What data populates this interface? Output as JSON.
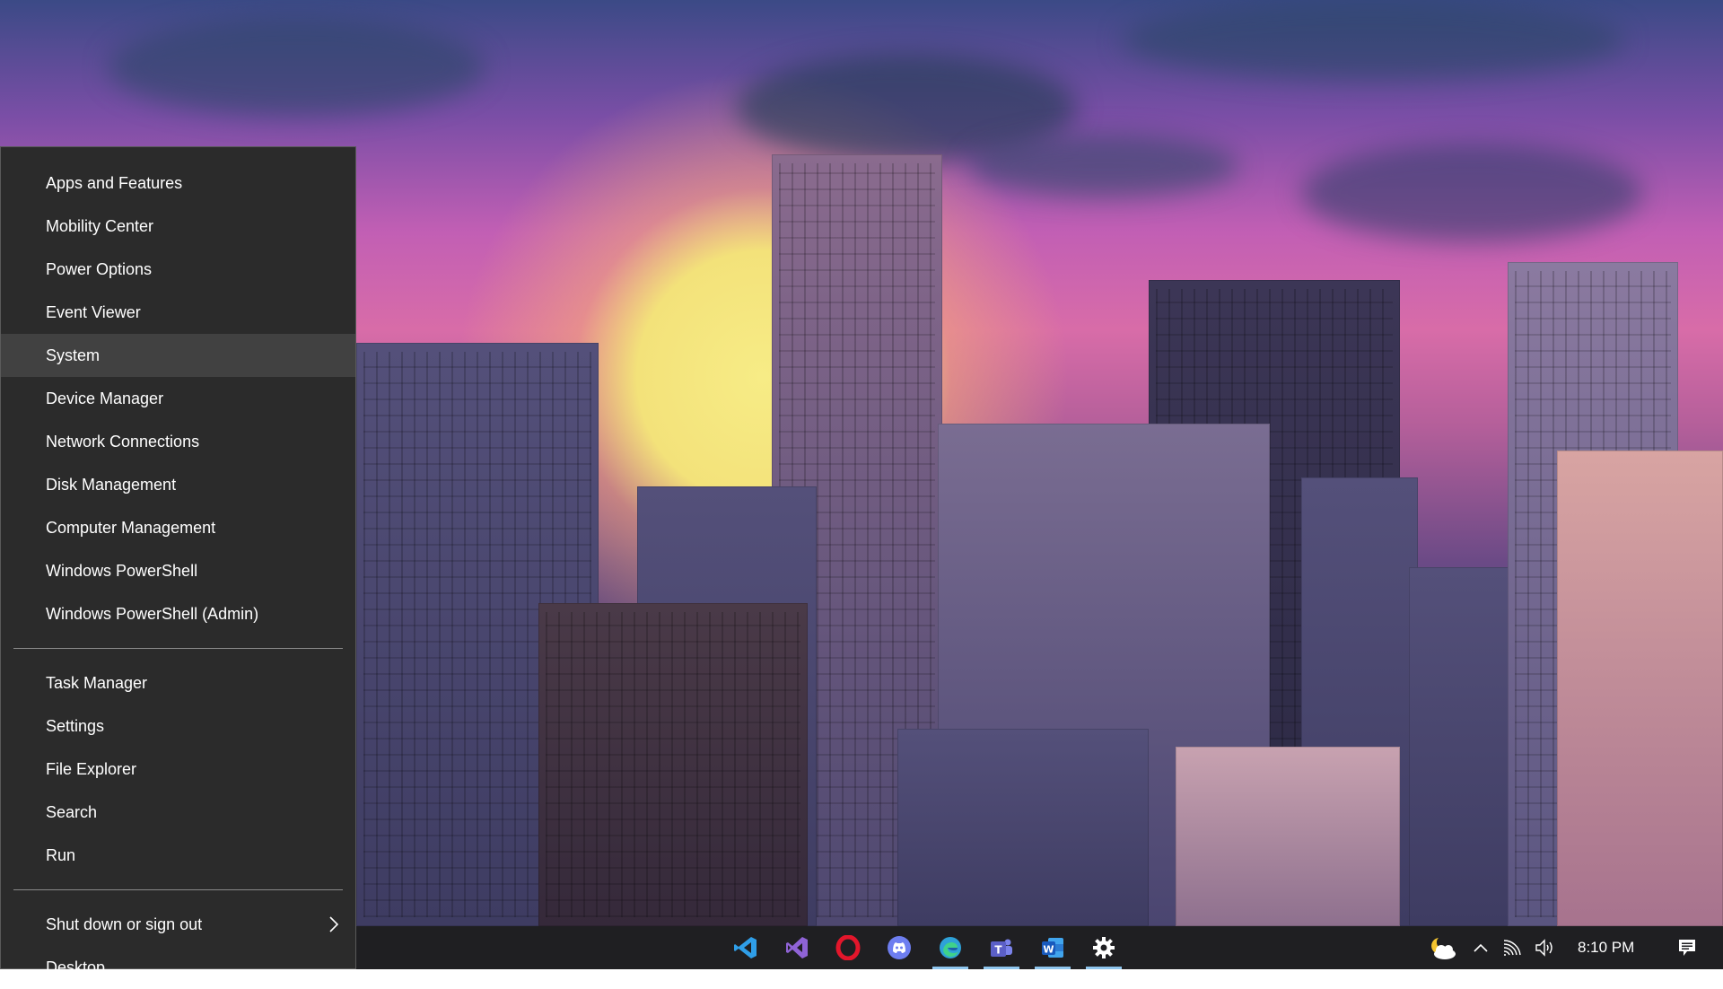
{
  "menu": {
    "sections": [
      {
        "items": [
          {
            "label": "Apps and Features",
            "selected": false
          },
          {
            "label": "Mobility Center",
            "selected": false
          },
          {
            "label": "Power Options",
            "selected": false
          },
          {
            "label": "Event Viewer",
            "selected": false
          },
          {
            "label": "System",
            "selected": true
          },
          {
            "label": "Device Manager",
            "selected": false
          },
          {
            "label": "Network Connections",
            "selected": false
          },
          {
            "label": "Disk Management",
            "selected": false
          },
          {
            "label": "Computer Management",
            "selected": false
          },
          {
            "label": "Windows PowerShell",
            "selected": false
          },
          {
            "label": "Windows PowerShell (Admin)",
            "selected": false
          }
        ]
      },
      {
        "items": [
          {
            "label": "Task Manager",
            "selected": false
          },
          {
            "label": "Settings",
            "selected": false
          },
          {
            "label": "File Explorer",
            "selected": false
          },
          {
            "label": "Search",
            "selected": false
          },
          {
            "label": "Run",
            "selected": false
          }
        ]
      },
      {
        "items": [
          {
            "label": "Shut down or sign out",
            "selected": false,
            "submenu": true
          },
          {
            "label": "Desktop",
            "selected": false
          }
        ]
      }
    ]
  },
  "taskbar": {
    "apps": [
      {
        "name": "vscode-icon",
        "running": false,
        "color": "#2f9ee8"
      },
      {
        "name": "visual-studio-icon",
        "running": false,
        "color": "#8f63d6"
      },
      {
        "name": "opera-icon",
        "running": false,
        "color": "#e3162b"
      },
      {
        "name": "discord-icon",
        "running": false,
        "color": "#6e7ef0"
      },
      {
        "name": "edge-icon",
        "running": true,
        "color": "#2ea1d8"
      },
      {
        "name": "teams-icon",
        "running": true,
        "color": "#5b5fc7"
      },
      {
        "name": "word-icon",
        "running": true,
        "color": "#2b65c0"
      },
      {
        "name": "settings-gear-icon",
        "running": true,
        "color": "#ffffff"
      }
    ],
    "tray": {
      "weather_icon": "partly-cloudy-night-icon",
      "chevron_icon": "chevron-up-icon",
      "network_icon": "wifi-icon",
      "volume_icon": "volume-icon",
      "notification_icon": "action-center-icon"
    },
    "clock": "8:10 PM"
  }
}
